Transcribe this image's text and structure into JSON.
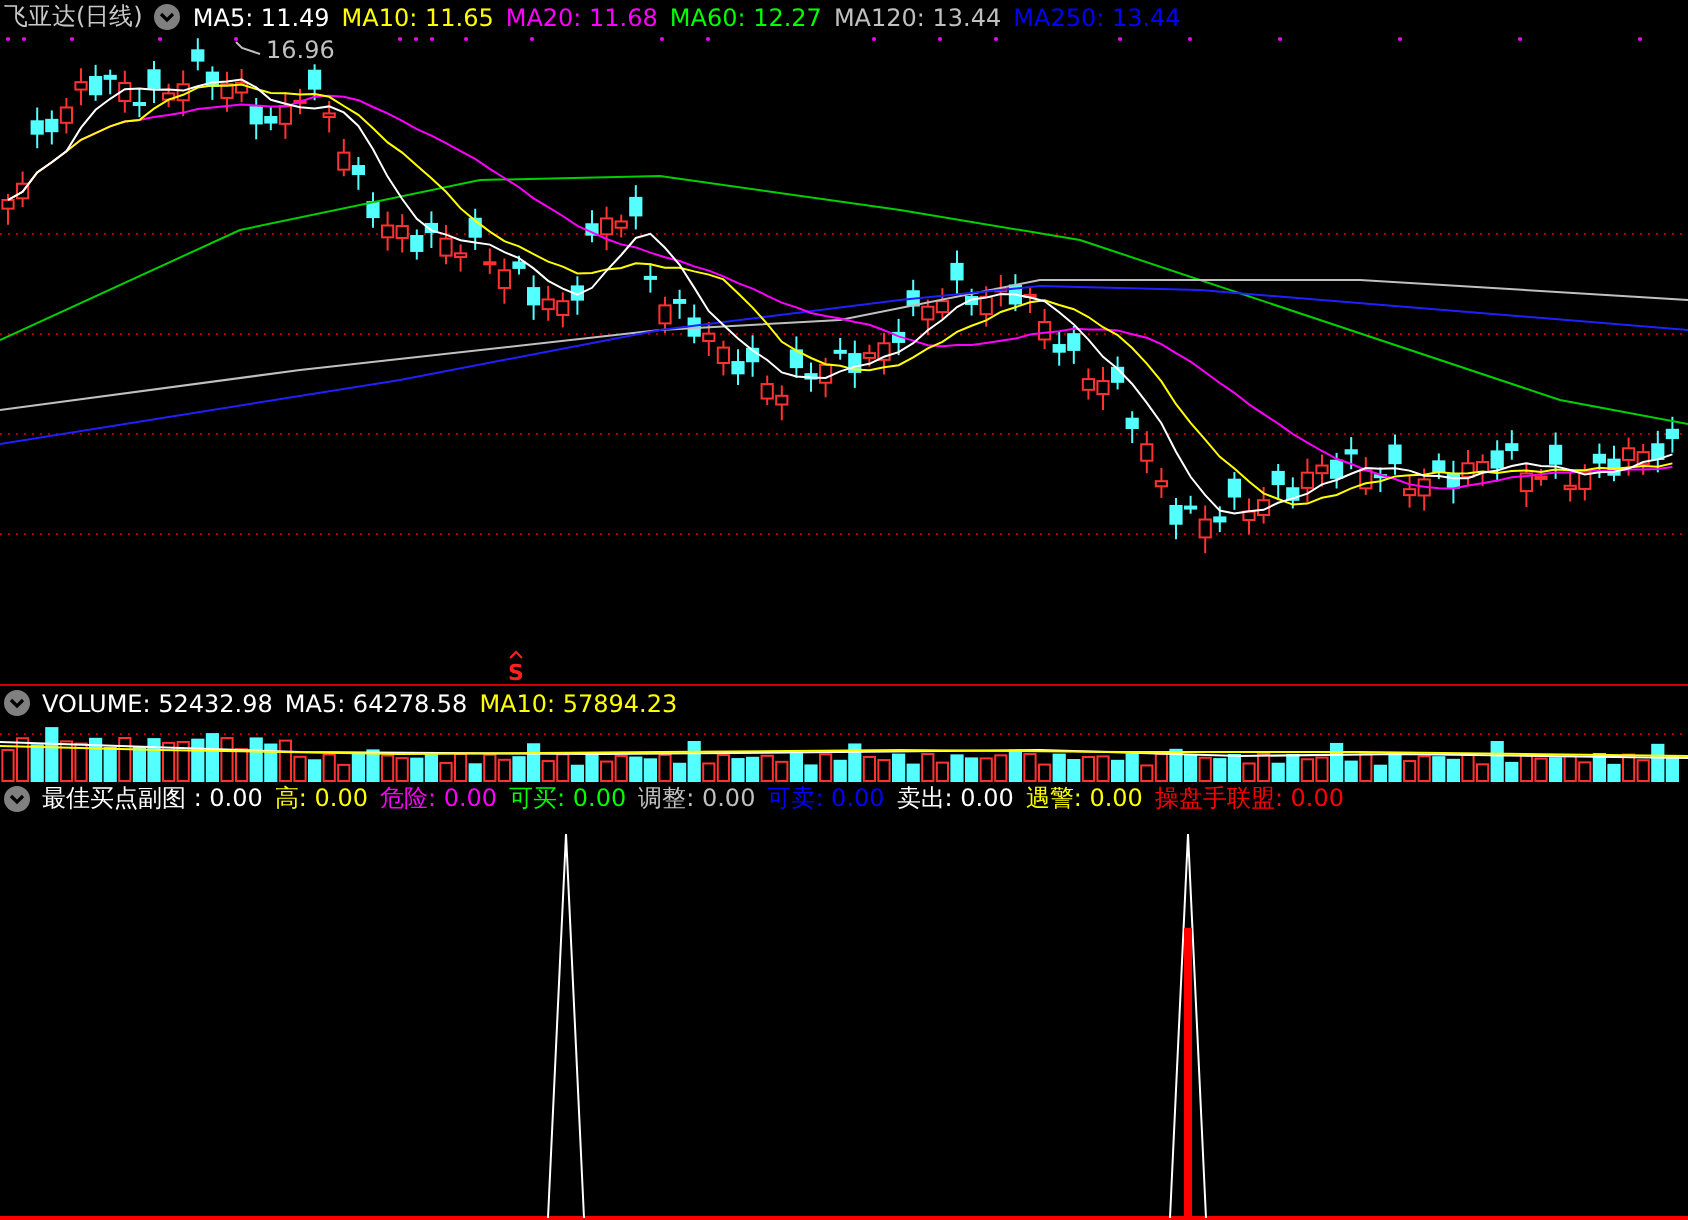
{
  "title": "飞亚达(日线)",
  "main_legend": [
    {
      "label": "MA5: 11.49",
      "color": "#ffffff"
    },
    {
      "label": "MA10: 11.65",
      "color": "#ffff00"
    },
    {
      "label": "MA20: 11.68",
      "color": "#ff00ff"
    },
    {
      "label": "MA60: 12.27",
      "color": "#00ff00"
    },
    {
      "label": "MA120: 13.44",
      "color": "#c0c0c0"
    },
    {
      "label": "MA250: 13.44",
      "color": "#0000ff"
    }
  ],
  "high_label": "16.96",
  "signal_label": "S",
  "volume_legend": [
    {
      "label": "VOLUME: 52432.98",
      "color": "#ffffff"
    },
    {
      "label": "MA5: 64278.58",
      "color": "#ffffff"
    },
    {
      "label": "MA10: 57894.23",
      "color": "#ffff00"
    }
  ],
  "indicator_legend": [
    {
      "label": "最佳买点副图 : 0.00",
      "color": "#ffffff"
    },
    {
      "label": "高: 0.00",
      "color": "#ffff00"
    },
    {
      "label": "危险: 0.00",
      "color": "#ff00ff"
    },
    {
      "label": "可买: 0.00",
      "color": "#00ff00"
    },
    {
      "label": "调整: 0.00",
      "color": "#c0c0c0"
    },
    {
      "label": "可卖: 0.00",
      "color": "#0000ff"
    },
    {
      "label": "卖出: 0.00",
      "color": "#ffffff"
    },
    {
      "label": "遇警: 0.00",
      "color": "#ffff00"
    },
    {
      "label": "操盘手联盟: 0.00",
      "color": "#ff0000"
    }
  ]
}
